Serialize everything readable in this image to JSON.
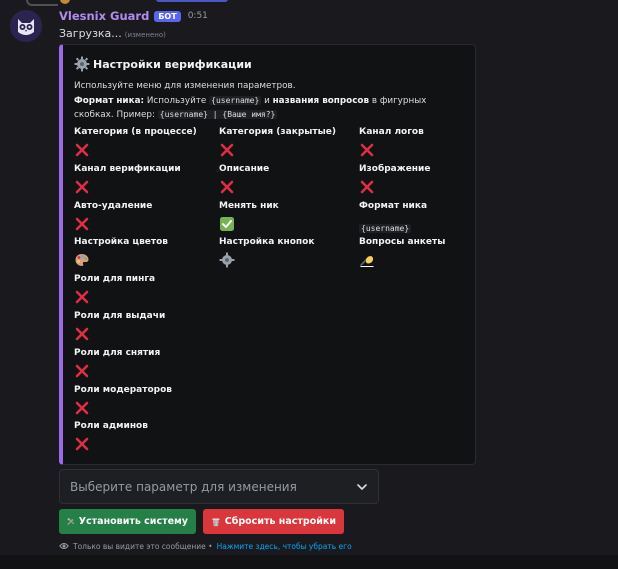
{
  "message": {
    "username": "Vlesnix Guard",
    "badge": "БОТ",
    "timestamp": "0:51",
    "text": "Загрузка...",
    "edited": "(изменено)"
  },
  "embed": {
    "title": "Настройки верификации",
    "accent_color": "#9a6ae8",
    "desc_line1": "Используйте меню для изменения параметров.",
    "format_label": "Формат ника:",
    "format_use": "Используйте",
    "format_code": "{username}",
    "format_and": "и",
    "format_bold": "названия вопросов",
    "format_rest": "в фигурных скобках. Пример:",
    "example_code": "{username} | {Ваше имя?}",
    "fields": [
      {
        "name": "Категория (в процессе)",
        "value_icon": "cross-mark-icon"
      },
      {
        "name": "Категория (закрытые)",
        "value_icon": "cross-mark-icon"
      },
      {
        "name": "Канал логов",
        "value_icon": "cross-mark-icon"
      },
      {
        "name": "Канал верификации",
        "value_icon": "cross-mark-icon"
      },
      {
        "name": "Описание",
        "value_icon": "cross-mark-icon"
      },
      {
        "name": "Изображение",
        "value_icon": "cross-mark-icon"
      },
      {
        "name": "Авто-удаление",
        "value_icon": "cross-mark-icon"
      },
      {
        "name": "Менять ник",
        "value_icon": "check-mark-icon"
      },
      {
        "name": "Формат ника",
        "value_text": "{username}"
      },
      {
        "name": "Настройка цветов",
        "value_icon": "palette-icon"
      },
      {
        "name": "Настройка кнопок",
        "value_icon": "gear-icon"
      },
      {
        "name": "Вопросы анкеты",
        "value_icon": "writing-hand-icon"
      },
      {
        "name": "Роли для пинга",
        "value_icon": "cross-mark-icon"
      },
      {
        "name": "Роли для выдачи",
        "value_icon": "cross-mark-icon"
      },
      {
        "name": "Роли для снятия",
        "value_icon": "cross-mark-icon"
      },
      {
        "name": "Роли модераторов",
        "value_icon": "cross-mark-icon"
      },
      {
        "name": "Роли админов",
        "value_icon": "cross-mark-icon"
      }
    ]
  },
  "select": {
    "placeholder": "Выберите параметр для изменения"
  },
  "buttons": {
    "install": "Установить систему",
    "install_icon": "tools-icon",
    "reset": "Сбросить настройки",
    "reset_icon": "wastebasket-icon"
  },
  "ephemeral": {
    "text": "Только вы видите это сообщение •",
    "link": "Нажмите здесь, чтобы убрать его"
  },
  "colors": {
    "green_button": "#248046",
    "red_button": "#da373c",
    "bot_badge": "#5865f2",
    "username": "#b18cf0"
  }
}
